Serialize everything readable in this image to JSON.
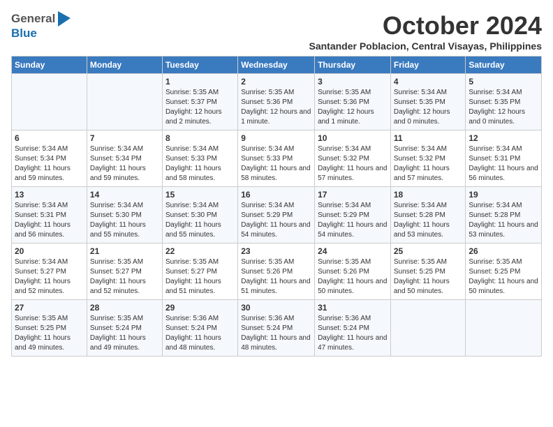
{
  "header": {
    "logo_general": "General",
    "logo_blue": "Blue",
    "month": "October 2024",
    "location": "Santander Poblacion, Central Visayas, Philippines"
  },
  "weekdays": [
    "Sunday",
    "Monday",
    "Tuesday",
    "Wednesday",
    "Thursday",
    "Friday",
    "Saturday"
  ],
  "weeks": [
    [
      {
        "day": "",
        "info": ""
      },
      {
        "day": "",
        "info": ""
      },
      {
        "day": "1",
        "info": "Sunrise: 5:35 AM\nSunset: 5:37 PM\nDaylight: 12 hours\nand 2 minutes."
      },
      {
        "day": "2",
        "info": "Sunrise: 5:35 AM\nSunset: 5:36 PM\nDaylight: 12 hours\nand 1 minute."
      },
      {
        "day": "3",
        "info": "Sunrise: 5:35 AM\nSunset: 5:36 PM\nDaylight: 12 hours\nand 1 minute."
      },
      {
        "day": "4",
        "info": "Sunrise: 5:34 AM\nSunset: 5:35 PM\nDaylight: 12 hours\nand 0 minutes."
      },
      {
        "day": "5",
        "info": "Sunrise: 5:34 AM\nSunset: 5:35 PM\nDaylight: 12 hours\nand 0 minutes."
      }
    ],
    [
      {
        "day": "6",
        "info": "Sunrise: 5:34 AM\nSunset: 5:34 PM\nDaylight: 11 hours\nand 59 minutes."
      },
      {
        "day": "7",
        "info": "Sunrise: 5:34 AM\nSunset: 5:34 PM\nDaylight: 11 hours\nand 59 minutes."
      },
      {
        "day": "8",
        "info": "Sunrise: 5:34 AM\nSunset: 5:33 PM\nDaylight: 11 hours\nand 58 minutes."
      },
      {
        "day": "9",
        "info": "Sunrise: 5:34 AM\nSunset: 5:33 PM\nDaylight: 11 hours\nand 58 minutes."
      },
      {
        "day": "10",
        "info": "Sunrise: 5:34 AM\nSunset: 5:32 PM\nDaylight: 11 hours\nand 57 minutes."
      },
      {
        "day": "11",
        "info": "Sunrise: 5:34 AM\nSunset: 5:32 PM\nDaylight: 11 hours\nand 57 minutes."
      },
      {
        "day": "12",
        "info": "Sunrise: 5:34 AM\nSunset: 5:31 PM\nDaylight: 11 hours\nand 56 minutes."
      }
    ],
    [
      {
        "day": "13",
        "info": "Sunrise: 5:34 AM\nSunset: 5:31 PM\nDaylight: 11 hours\nand 56 minutes."
      },
      {
        "day": "14",
        "info": "Sunrise: 5:34 AM\nSunset: 5:30 PM\nDaylight: 11 hours\nand 55 minutes."
      },
      {
        "day": "15",
        "info": "Sunrise: 5:34 AM\nSunset: 5:30 PM\nDaylight: 11 hours\nand 55 minutes."
      },
      {
        "day": "16",
        "info": "Sunrise: 5:34 AM\nSunset: 5:29 PM\nDaylight: 11 hours\nand 54 minutes."
      },
      {
        "day": "17",
        "info": "Sunrise: 5:34 AM\nSunset: 5:29 PM\nDaylight: 11 hours\nand 54 minutes."
      },
      {
        "day": "18",
        "info": "Sunrise: 5:34 AM\nSunset: 5:28 PM\nDaylight: 11 hours\nand 53 minutes."
      },
      {
        "day": "19",
        "info": "Sunrise: 5:34 AM\nSunset: 5:28 PM\nDaylight: 11 hours\nand 53 minutes."
      }
    ],
    [
      {
        "day": "20",
        "info": "Sunrise: 5:34 AM\nSunset: 5:27 PM\nDaylight: 11 hours\nand 52 minutes."
      },
      {
        "day": "21",
        "info": "Sunrise: 5:35 AM\nSunset: 5:27 PM\nDaylight: 11 hours\nand 52 minutes."
      },
      {
        "day": "22",
        "info": "Sunrise: 5:35 AM\nSunset: 5:27 PM\nDaylight: 11 hours\nand 51 minutes."
      },
      {
        "day": "23",
        "info": "Sunrise: 5:35 AM\nSunset: 5:26 PM\nDaylight: 11 hours\nand 51 minutes."
      },
      {
        "day": "24",
        "info": "Sunrise: 5:35 AM\nSunset: 5:26 PM\nDaylight: 11 hours\nand 50 minutes."
      },
      {
        "day": "25",
        "info": "Sunrise: 5:35 AM\nSunset: 5:25 PM\nDaylight: 11 hours\nand 50 minutes."
      },
      {
        "day": "26",
        "info": "Sunrise: 5:35 AM\nSunset: 5:25 PM\nDaylight: 11 hours\nand 50 minutes."
      }
    ],
    [
      {
        "day": "27",
        "info": "Sunrise: 5:35 AM\nSunset: 5:25 PM\nDaylight: 11 hours\nand 49 minutes."
      },
      {
        "day": "28",
        "info": "Sunrise: 5:35 AM\nSunset: 5:24 PM\nDaylight: 11 hours\nand 49 minutes."
      },
      {
        "day": "29",
        "info": "Sunrise: 5:36 AM\nSunset: 5:24 PM\nDaylight: 11 hours\nand 48 minutes."
      },
      {
        "day": "30",
        "info": "Sunrise: 5:36 AM\nSunset: 5:24 PM\nDaylight: 11 hours\nand 48 minutes."
      },
      {
        "day": "31",
        "info": "Sunrise: 5:36 AM\nSunset: 5:24 PM\nDaylight: 11 hours\nand 47 minutes."
      },
      {
        "day": "",
        "info": ""
      },
      {
        "day": "",
        "info": ""
      }
    ]
  ]
}
